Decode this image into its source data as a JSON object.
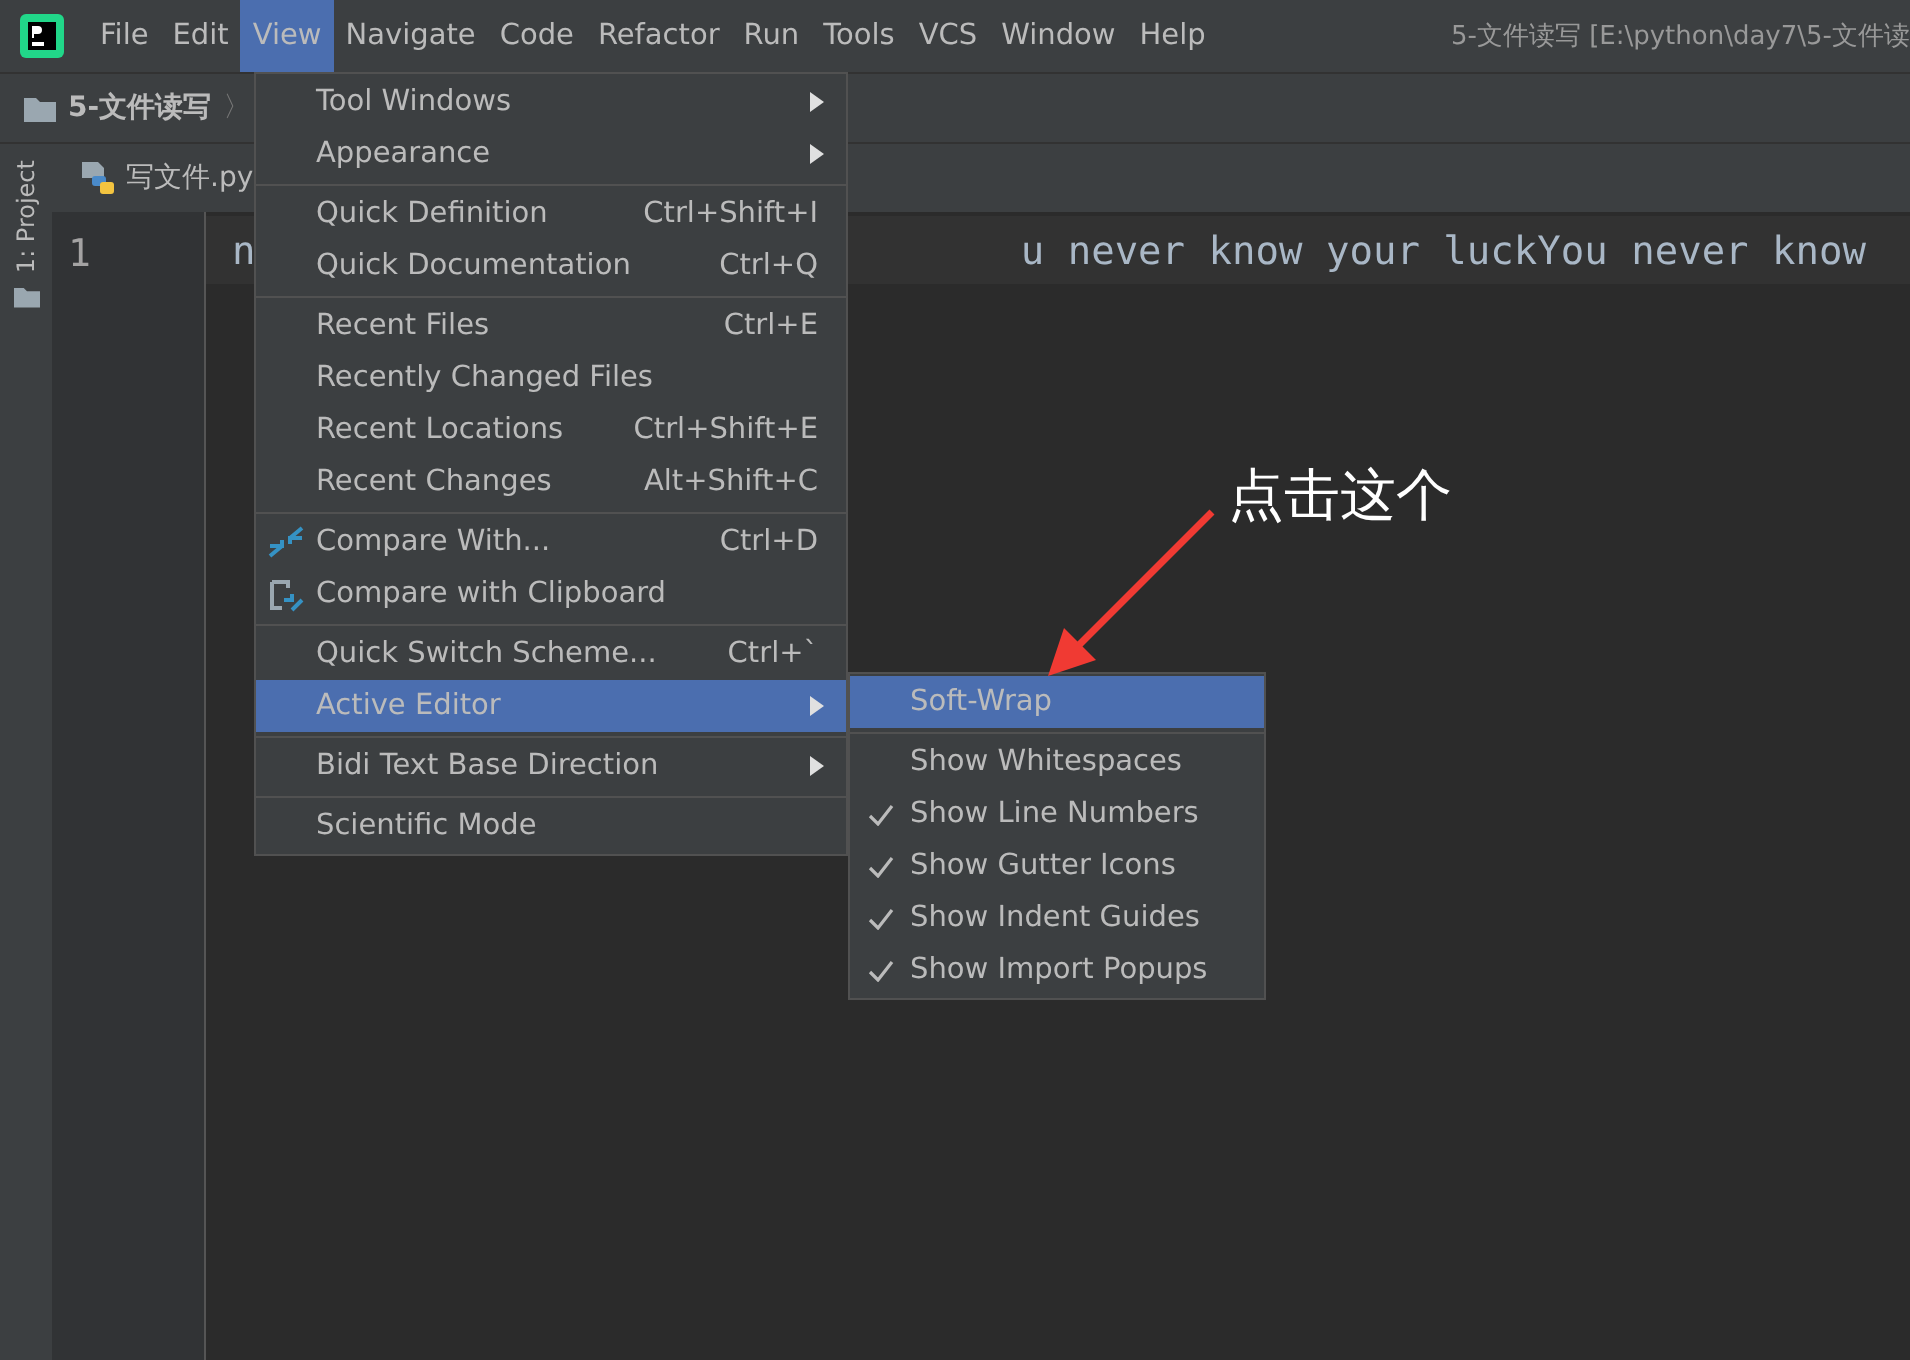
{
  "menu_bar": {
    "items": [
      {
        "label": "File",
        "selected": false
      },
      {
        "label": "Edit",
        "selected": false
      },
      {
        "label": "View",
        "selected": true
      },
      {
        "label": "Navigate",
        "selected": false
      },
      {
        "label": "Code",
        "selected": false
      },
      {
        "label": "Refactor",
        "selected": false
      },
      {
        "label": "Run",
        "selected": false
      },
      {
        "label": "Tools",
        "selected": false
      },
      {
        "label": "VCS",
        "selected": false
      },
      {
        "label": "Window",
        "selected": false
      },
      {
        "label": "Help",
        "selected": false
      }
    ],
    "title": "5-文件读写 [E:\\python\\day7\\5-文件读"
  },
  "breadcrumb": {
    "project": "5-文件读写",
    "separator": "〉"
  },
  "tool_stripe": {
    "label": "1: Project"
  },
  "editor_tab": {
    "label": "写文件.py"
  },
  "editor": {
    "line_number": "1",
    "code_start": "n",
    "code_end": "u never know your luckYou never know"
  },
  "view_menu": {
    "groups": [
      [
        {
          "label": "Tool Windows",
          "submenu": true,
          "selected": false
        },
        {
          "label": "Appearance",
          "submenu": true,
          "selected": false
        }
      ],
      [
        {
          "label": "Quick Definition",
          "shortcut": "Ctrl+Shift+I",
          "selected": false
        },
        {
          "label": "Quick Documentation",
          "shortcut": "Ctrl+Q",
          "selected": false
        }
      ],
      [
        {
          "label": "Recent Files",
          "shortcut": "Ctrl+E",
          "selected": false
        },
        {
          "label": "Recently Changed Files",
          "selected": false
        },
        {
          "label": "Recent Locations",
          "shortcut": "Ctrl+Shift+E",
          "selected": false
        },
        {
          "label": "Recent Changes",
          "shortcut": "Alt+Shift+C",
          "selected": false
        }
      ],
      [
        {
          "label": "Compare With...",
          "shortcut": "Ctrl+D",
          "kind": "compare",
          "selected": false
        },
        {
          "label": "Compare with Clipboard",
          "kind": "clipboard",
          "selected": false
        }
      ],
      [
        {
          "label": "Quick Switch Scheme...",
          "shortcut": "Ctrl+`",
          "selected": false
        },
        {
          "label": "Active Editor",
          "submenu": true,
          "selected": true
        }
      ],
      [
        {
          "label": "Bidi Text Base Direction",
          "submenu": true,
          "selected": false
        }
      ],
      [
        {
          "label": "Scientific Mode",
          "selected": false
        }
      ]
    ]
  },
  "submenu": {
    "groups": [
      [
        {
          "label": "Soft-Wrap",
          "checked": false,
          "selected": true
        }
      ],
      [
        {
          "label": "Show Whitespaces",
          "checked": false,
          "selected": false
        },
        {
          "label": "Show Line Numbers",
          "checked": true,
          "selected": false
        },
        {
          "label": "Show Gutter Icons",
          "checked": true,
          "selected": false
        },
        {
          "label": "Show Indent Guides",
          "checked": true,
          "selected": false
        },
        {
          "label": "Show Import Popups",
          "checked": true,
          "selected": false
        }
      ]
    ]
  },
  "annotation": {
    "text": "点击这个"
  }
}
